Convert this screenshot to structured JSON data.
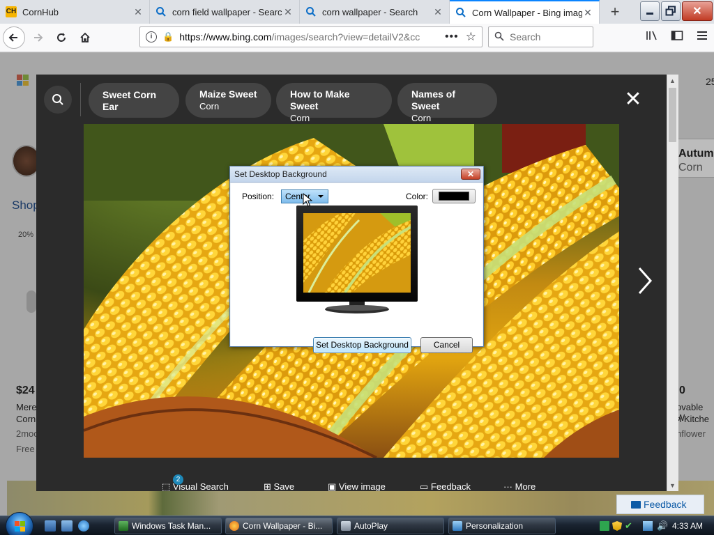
{
  "browser": {
    "tabs": [
      {
        "title": "CornHub",
        "favicon": "cornhub-favicon-icon",
        "active": false
      },
      {
        "title": "corn field wallpaper - Search",
        "favicon": "search-favicon-icon",
        "active": false
      },
      {
        "title": "corn wallpaper - Search",
        "favicon": "search-favicon-icon",
        "active": false
      },
      {
        "title": "Corn Wallpaper - Bing images",
        "favicon": "search-favicon-icon",
        "active": true
      }
    ],
    "new_tab": "+",
    "url": "https://www.bing.com/images/search?view=detailV2&ccid",
    "url_host": "https://www.bing.com",
    "url_rest": "/images/search?view=detailV2&cc",
    "search_placeholder": "Search"
  },
  "background_page": {
    "top_right_number": "25",
    "autumn_label": "Autumn",
    "corn_label": "Corn",
    "shop_label": "Shop",
    "discount": "20%",
    "price_left": "$24",
    "item_left_line1": "Mere",
    "item_left_line2": "Corn",
    "item_left_line3": "2moo",
    "item_left_line4": "Free",
    "price_right": "0",
    "item_right_line1": "ovable W",
    "item_right_line2": "n Kitche",
    "item_right_line3": "nflower"
  },
  "viewer": {
    "related": [
      {
        "title": "Sweet Corn Ear",
        "sub": ""
      },
      {
        "title": "Maize Sweet",
        "sub": "Corn"
      },
      {
        "title": "How to Make Sweet",
        "sub": "Corn"
      },
      {
        "title": "Names of Sweet",
        "sub": "Corn"
      }
    ],
    "bottom_actions": {
      "visual_search": "Visual Search",
      "visual_search_badge": "2",
      "save": "Save",
      "view_image": "View image",
      "feedback": "Feedback",
      "more": "More"
    }
  },
  "dialog": {
    "title": "Set Desktop Background",
    "position_label": "Position:",
    "position_value": "Center",
    "color_label": "Color:",
    "color_value": "#000000",
    "set_button": "Set Desktop Background",
    "cancel_button": "Cancel"
  },
  "page_feedback": "Feedback",
  "taskbar": {
    "tasks": [
      {
        "label": "Windows Task Man...",
        "active": false
      },
      {
        "label": "Corn Wallpaper - Bi...",
        "active": true
      },
      {
        "label": "AutoPlay",
        "active": false
      },
      {
        "label": "Personalization",
        "active": false
      }
    ],
    "clock": "4:33 AM"
  },
  "colors": {
    "accent_tab": "#0a84ff",
    "viewer_bg": "#2b2b2b",
    "pill_bg": "#444444",
    "dialog_border": "#5d7fa8",
    "link_blue": "#0c5aa6"
  }
}
